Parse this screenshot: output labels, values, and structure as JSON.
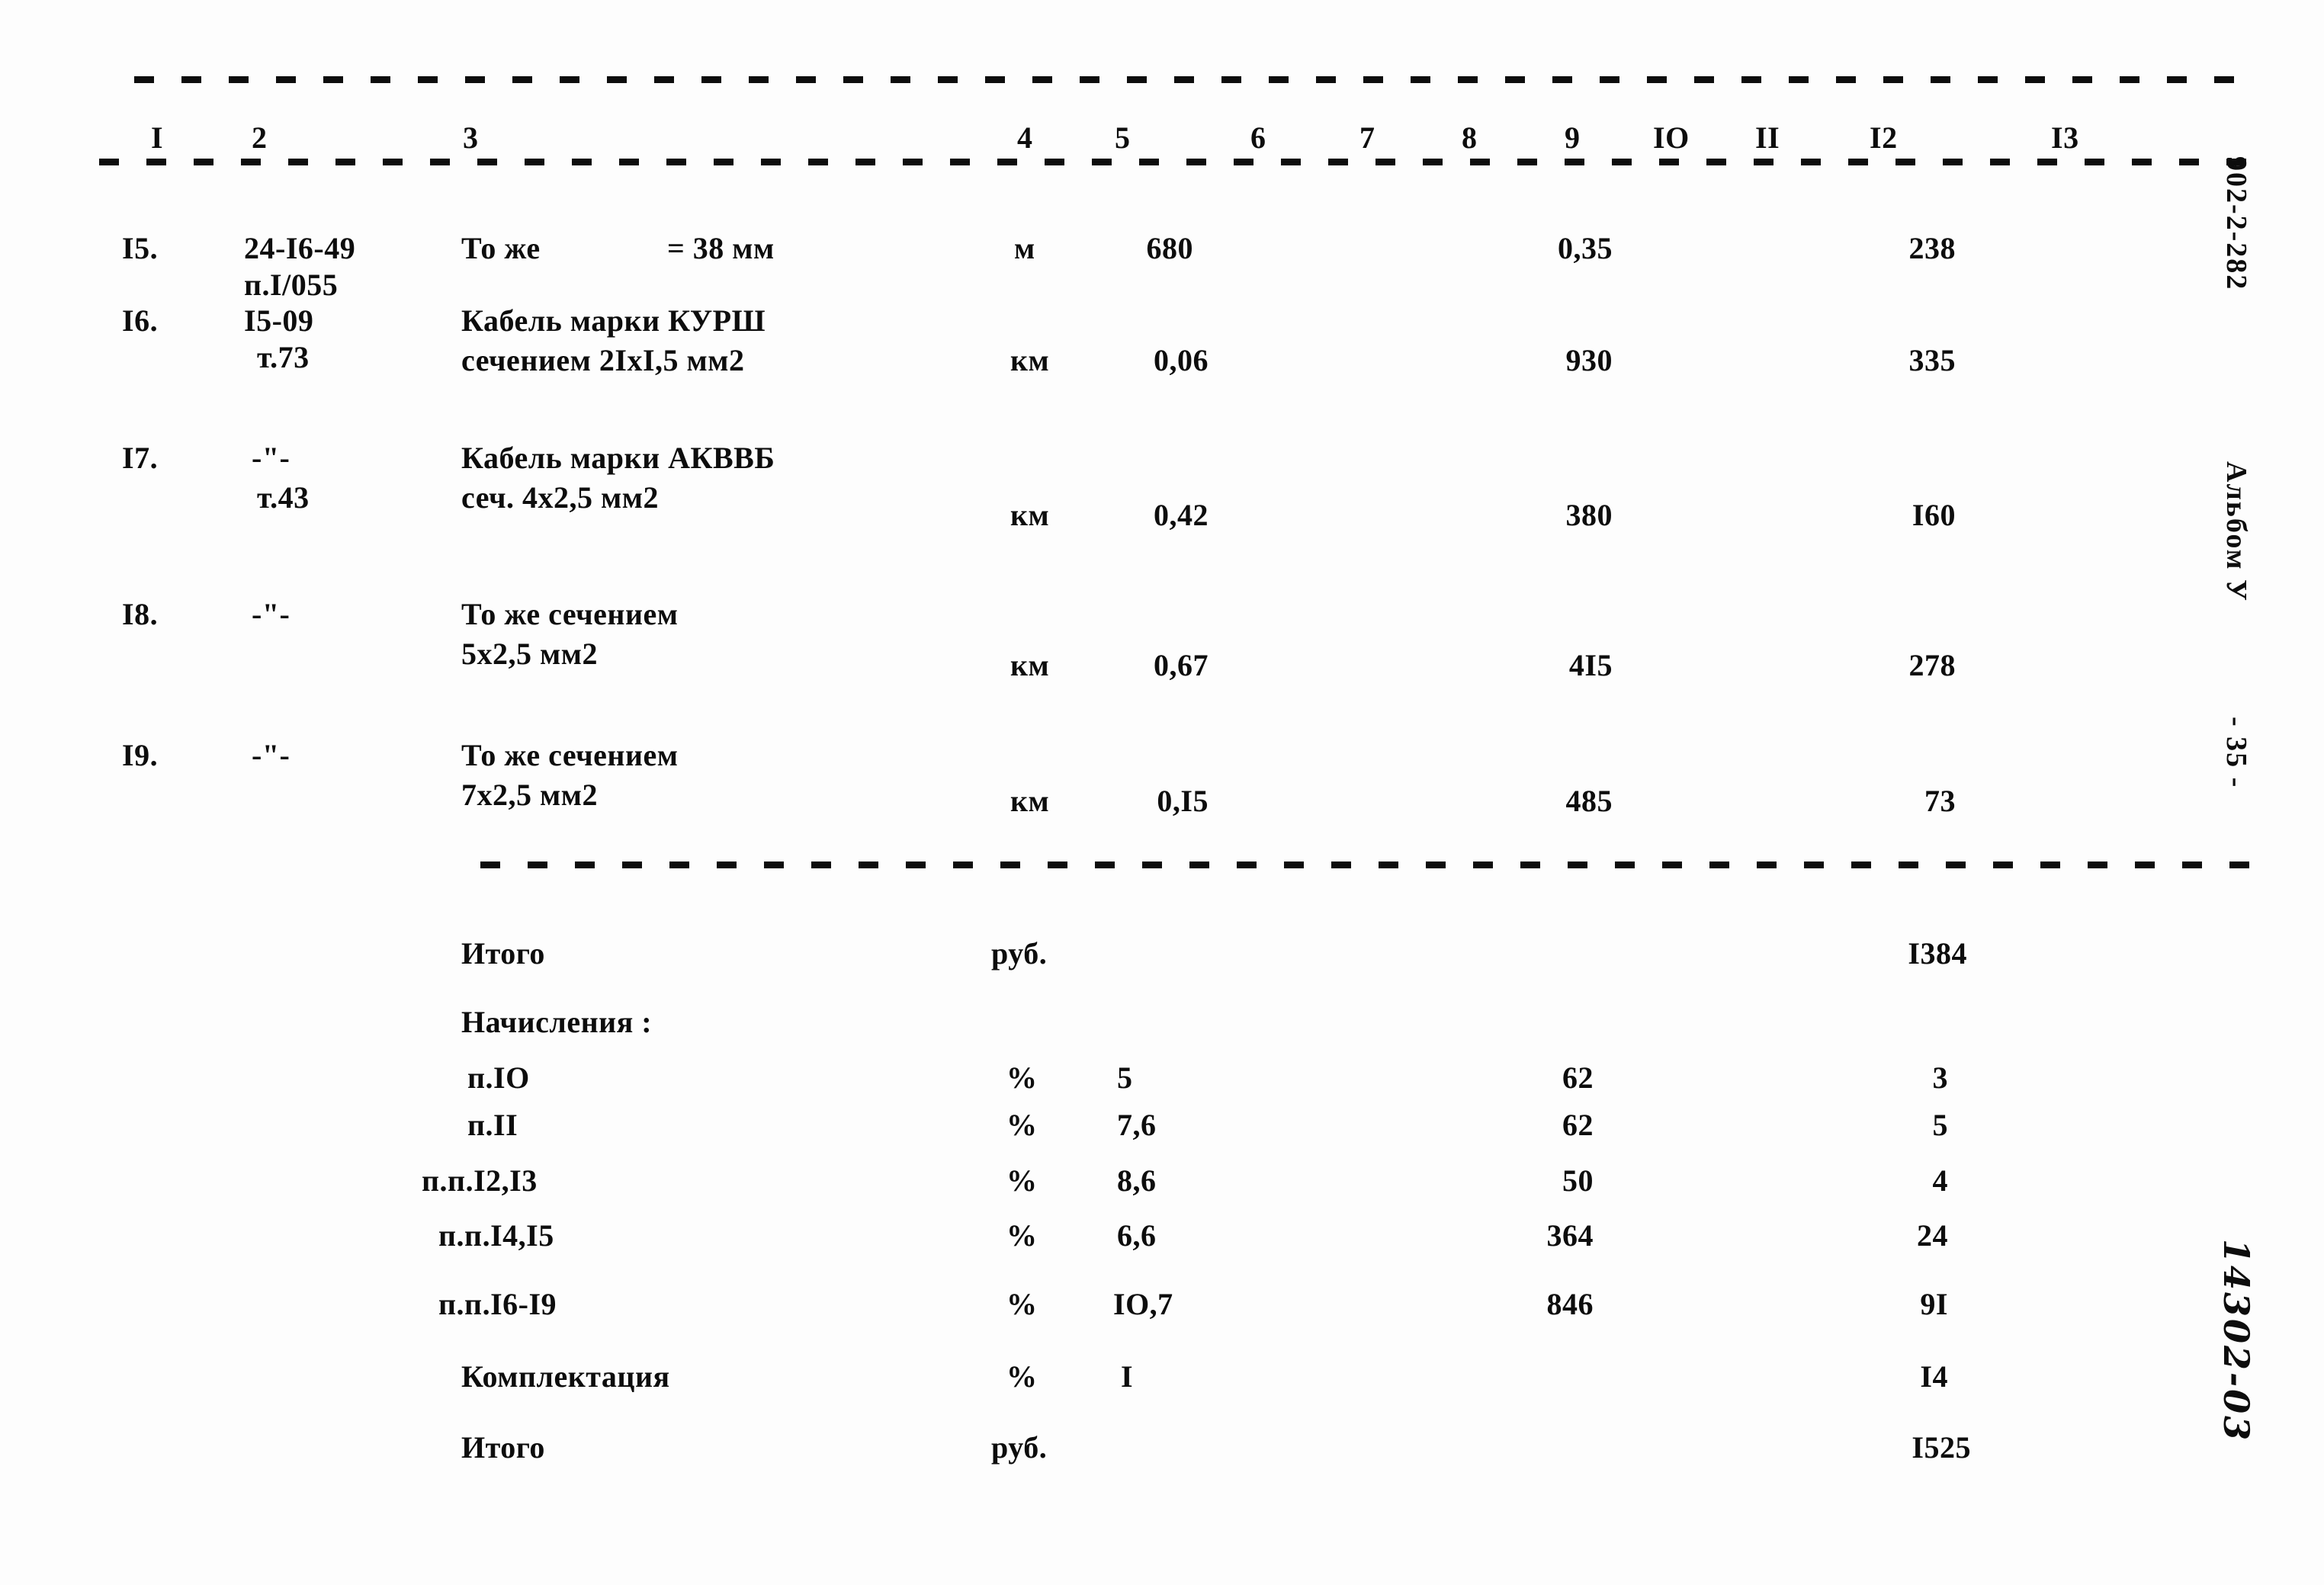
{
  "document": {
    "sheet_code": "902-2-282",
    "album": "Альбом У",
    "page_number": "- 35 -",
    "handwritten_ref": "14302-03"
  },
  "table": {
    "column_numbers": [
      "I",
      "2",
      "3",
      "4",
      "5",
      "6",
      "7",
      "8",
      "9",
      "IO",
      "II",
      "I2",
      "I3"
    ],
    "rows": [
      {
        "no": "I5.",
        "ref_line1": "24-I6-49",
        "ref_line2": "п.I/055",
        "desc_line1": "То же",
        "desc_extra": "= 38 мм",
        "desc_line2": "",
        "unit": "м",
        "qty": "680",
        "price": "0,35",
        "total": "238"
      },
      {
        "no": "I6.",
        "ref_line1": "I5-09",
        "ref_line2": "т.73",
        "desc_line1": "Кабель марки КУРШ",
        "desc_extra": "",
        "desc_line2": "сечением 2IxI,5 мм2",
        "unit": "км",
        "qty": "0,06",
        "price": "930",
        "total": "335"
      },
      {
        "no": "I7.",
        "ref_line1": "-\"-",
        "ref_line2": "т.43",
        "desc_line1": "Кабель марки АКВВБ",
        "desc_extra": "",
        "desc_line2": "сеч. 4х2,5 мм2",
        "unit": "км",
        "qty": "0,42",
        "price": "380",
        "total": "I60"
      },
      {
        "no": "I8.",
        "ref_line1": "-\"-",
        "ref_line2": "",
        "desc_line1": "То же сечением",
        "desc_extra": "",
        "desc_line2": "5х2,5 мм2",
        "unit": "км",
        "qty": "0,67",
        "price": "4I5",
        "total": "278"
      },
      {
        "no": "I9.",
        "ref_line1": "-\"-",
        "ref_line2": "",
        "desc_line1": "То же сечением",
        "desc_extra": "",
        "desc_line2": "7х2,5 мм2",
        "unit": "км",
        "qty": "0,I5",
        "price": "485",
        "total": "73"
      }
    ]
  },
  "summary": {
    "subtotal": {
      "label": "Итого",
      "unit": "руб.",
      "total": "I384"
    },
    "charges_heading": "Начисления :",
    "charges": [
      {
        "label": "п.IO",
        "unit": "%",
        "rate": "5",
        "base": "62",
        "amount": "3"
      },
      {
        "label": "п.II",
        "unit": "%",
        "rate": "7,6",
        "base": "62",
        "amount": "5"
      },
      {
        "label": "п.п.I2,I3",
        "unit": "%",
        "rate": "8,6",
        "base": "50",
        "amount": "4"
      },
      {
        "label": "п.п.I4,I5",
        "unit": "%",
        "rate": "6,6",
        "base": "364",
        "amount": "24"
      },
      {
        "label": "п.п.I6-I9",
        "unit": "%",
        "rate": "IO,7",
        "base": "846",
        "amount": "9I"
      }
    ],
    "completion": {
      "label": "Комплектация",
      "unit": "%",
      "rate": "I",
      "base": "",
      "amount": "I4"
    },
    "grand_total": {
      "label": "Итого",
      "unit": "руб.",
      "total": "I525"
    }
  }
}
